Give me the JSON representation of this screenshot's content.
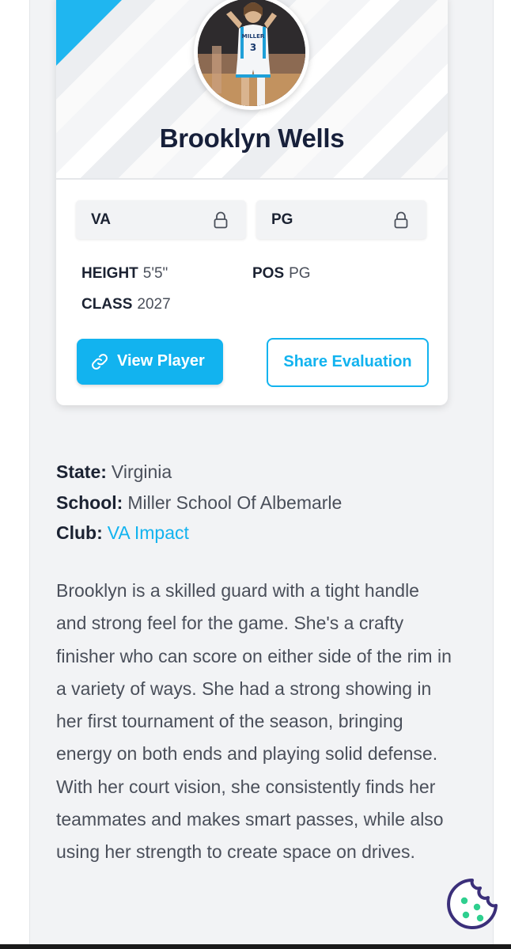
{
  "player": {
    "name": "Brooklyn Wells",
    "chips": [
      {
        "label": "VA",
        "icon": "lock-icon"
      },
      {
        "label": "PG",
        "icon": "lock-icon"
      }
    ],
    "stats": {
      "height_label": "HEIGHT",
      "height_value": "5'5\"",
      "pos_label": "POS",
      "pos_value": "PG",
      "class_label": "CLASS",
      "class_value": "2027"
    },
    "buttons": {
      "view_label": "View Player",
      "share_label": "Share Evaluation"
    }
  },
  "info": {
    "state_label": "State:",
    "state_value": "Virginia",
    "school_label": "School:",
    "school_value": "Miller School Of Albemarle",
    "club_label": "Club:",
    "club_value": "VA Impact"
  },
  "bio": "Brooklyn is a skilled guard with a tight handle and strong feel for the game. She's a crafty finisher who can score on either side of the rim in a variety of ways. She had a strong showing in her first tournament of the season, bringing energy on both ends and playing solid defense. With her court vision, she consistently finds her teammates and makes smart passes, while also using her strength to create space on drives.",
  "jersey": {
    "team": "MILLER",
    "number": "3"
  },
  "colors": {
    "accent": "#12b3ef",
    "heading": "#17203a",
    "body_text": "#4a4f5a",
    "cookie": "#3b2f7a",
    "cookie_dots": "#2fcf8f"
  },
  "icons": {
    "view_button": "link-icon",
    "cookie": "cookie-icon"
  }
}
